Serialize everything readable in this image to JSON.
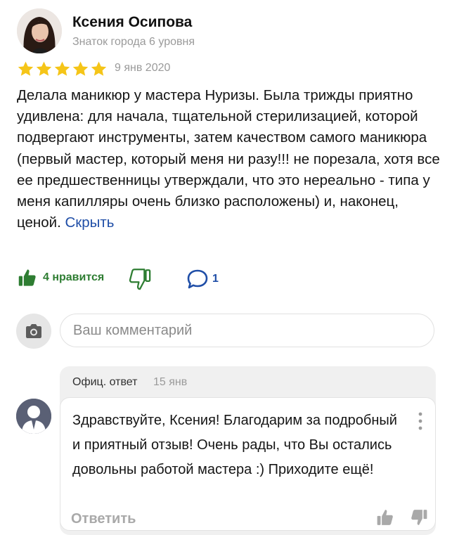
{
  "review": {
    "author_name": "Ксения Осипова",
    "author_level": "Знаток города 6 уровня",
    "rating": 5,
    "date": "9 янв 2020",
    "text": "Делала маникюр у мастера Нуризы. Была трижды приятно удивлена: для начала, тщательной стерилизацией, которой подвергают инструменты, затем качеством самого маникюра (первый мастер, который меня ни разу!!! не порезала, хотя все ее предшественницы утверждали, что это нереально - типа у меня капилляры очень близко расположены) и, наконец, ценой. ",
    "hide_link": "Скрыть",
    "likes_label": "4 нравится",
    "comments_count": "1"
  },
  "comment_input": {
    "placeholder": "Ваш комментарий"
  },
  "reply": {
    "label": "Офиц. ответ",
    "date": "15 янв",
    "text": "Здравствуйте, Ксения! Благодарим за подробный и приятный отзыв! Очень рады, что Вы остались довольны работой мастера :) Приходите ещё!",
    "reply_action": "Ответить"
  },
  "colors": {
    "star": "#f5c518",
    "like_green": "#2e7d32",
    "link_blue": "#1f4ea7",
    "muted": "#9a9a9a"
  },
  "icons": [
    "avatar-photo",
    "star-icon",
    "thumbs-up-icon",
    "thumbs-down-icon",
    "comment-bubble-icon",
    "camera-icon",
    "user-silhouette-icon",
    "more-vertical-icon"
  ]
}
